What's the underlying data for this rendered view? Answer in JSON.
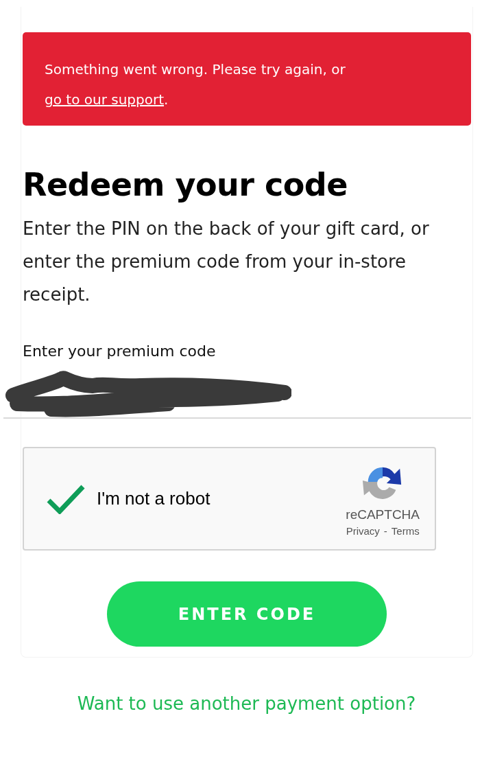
{
  "alert": {
    "text": "Something went wrong. Please try again, or",
    "link": "go to our support",
    "after": "."
  },
  "heading": "Redeem your code",
  "description": "Enter the PIN on the back of your gift card, or enter the premium code from your in-store receipt.",
  "code_field": {
    "label": "Enter your premium code",
    "redacted": true
  },
  "captcha": {
    "label": "I'm not a robot",
    "checked": true,
    "brand": "reCAPTCHA",
    "privacy": "Privacy",
    "separator": "-",
    "terms": "Terms"
  },
  "submit_button": "ENTER CODE",
  "alt_link": "Want to use another payment option?"
}
